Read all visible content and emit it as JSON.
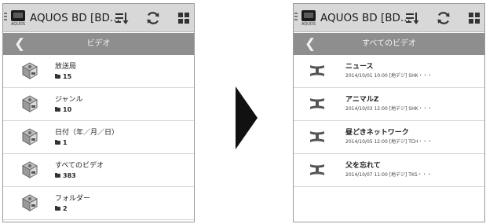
{
  "app": {
    "title": "AQUOS BD [BD...",
    "logo_label": "AQUOS",
    "actions": [
      {
        "icon": "sort-icon"
      },
      {
        "icon": "refresh-icon"
      },
      {
        "icon": "grid-icon"
      }
    ]
  },
  "left_screen": {
    "header_title": "ビデオ",
    "back_glyph": "❮",
    "items": [
      {
        "name": "放送局",
        "count": "15"
      },
      {
        "name": "ジャンル",
        "count": "10"
      },
      {
        "name": "日付（年／月／日）",
        "count": "1"
      },
      {
        "name": "すべてのビデオ",
        "count": "383"
      },
      {
        "name": "フォルダー",
        "count": "2"
      }
    ]
  },
  "right_screen": {
    "header_title": "すべてのビデオ",
    "back_glyph": "❮",
    "items": [
      {
        "title": "ニュース",
        "meta": "2014/10/01 10:00 [地デジ] SHK・・・"
      },
      {
        "title": "アニマルZ",
        "meta": "2014/10/03 12:00 [地デジ] SHK・・・"
      },
      {
        "title": "昼どきネットワーク",
        "meta": "2014/10/05 12:00 [地デジ] TCH・・・"
      },
      {
        "title": "父を忘れて",
        "meta": "2014/10/07 11:00 [地デジ] TKS・・・"
      }
    ]
  },
  "colors": {
    "appbar": "#d8d8d8",
    "subbar": "#8e8e8e",
    "divider": "#d6d6d6",
    "arrow": "#111111"
  }
}
